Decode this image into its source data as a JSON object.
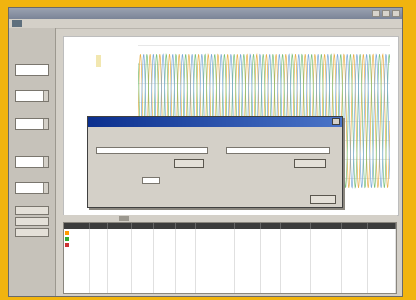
{
  "window": {
    "title": ""
  },
  "menu": {
    "items": [
      "",
      "",
      "",
      "",
      ""
    ]
  },
  "left_panel": {
    "labels": [
      "",
      "",
      "",
      "",
      ""
    ],
    "fields": [
      "",
      "",
      "",
      "",
      ""
    ],
    "buttons": [
      "",
      "",
      ""
    ]
  },
  "chart": {
    "x_labels": [
      "",
      "",
      ""
    ]
  },
  "dialog": {
    "title": "",
    "group_left_label": "",
    "group_right_label": "",
    "input_left_value": "",
    "input_right_value": "",
    "browse_left": "",
    "browse_right": "",
    "option_label": "",
    "option_value": "",
    "ok_label": ""
  },
  "table": {
    "headers": [
      "",
      "",
      "",
      "",
      "",
      "",
      "",
      "",
      "",
      "",
      "",
      "",
      ""
    ],
    "rows": [
      {
        "color": "#ff9900",
        "cells": [
          "",
          "",
          "",
          "",
          "",
          "",
          "",
          "",
          "",
          "",
          "",
          "",
          ""
        ]
      },
      {
        "color": "#33aa33",
        "cells": [
          "",
          "",
          "",
          "",
          "",
          "",
          "",
          "",
          "",
          "",
          "",
          "",
          ""
        ]
      },
      {
        "color": "#cc3333",
        "cells": [
          "",
          "",
          "",
          "",
          "",
          "",
          "",
          "",
          "",
          "",
          "",
          "",
          ""
        ]
      }
    ]
  },
  "chart_data": {
    "type": "line",
    "series": [
      {
        "color": "#e8b04a",
        "cycles": 26
      },
      {
        "color": "#7ac07a",
        "cycles": 26
      },
      {
        "color": "#7aa9d8",
        "cycles": 26
      }
    ]
  }
}
